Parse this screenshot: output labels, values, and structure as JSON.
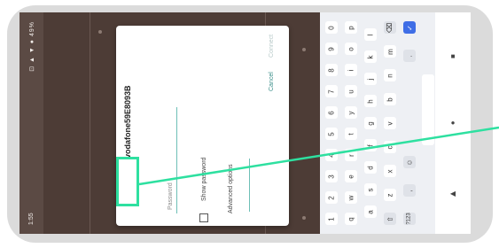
{
  "status_bar": {
    "time": "1:55",
    "icons": "⊡ ▲ ▼ ● 49%"
  },
  "dialog": {
    "title": "vodafone59E8093B",
    "password_placeholder": "Password",
    "show_password_label": "Show password",
    "advanced_options_label": "Advanced options",
    "cancel_label": "Cancel",
    "connect_label": "Connect"
  },
  "keyboard": {
    "row_numbers": [
      "1",
      "2",
      "3",
      "4",
      "5",
      "6",
      "7",
      "8",
      "9",
      "0"
    ],
    "row_top": [
      "q",
      "w",
      "e",
      "r",
      "t",
      "y",
      "u",
      "i",
      "o",
      "p"
    ],
    "row_home": [
      "a",
      "s",
      "d",
      "f",
      "g",
      "h",
      "j",
      "k",
      "l"
    ],
    "row_bottom": [
      "⇧",
      "z",
      "x",
      "c",
      "v",
      "b",
      "n",
      "m",
      "⌫"
    ],
    "row_fn": [
      "?123",
      ",",
      "☺",
      ".",
      "✓"
    ]
  },
  "nav": {
    "back_glyph": "◀",
    "home_glyph": "●",
    "recents_glyph": "■"
  },
  "colors": {
    "highlight": "#2ee0a0",
    "accent": "#3a8e89",
    "action_key": "#3f6ee6"
  }
}
